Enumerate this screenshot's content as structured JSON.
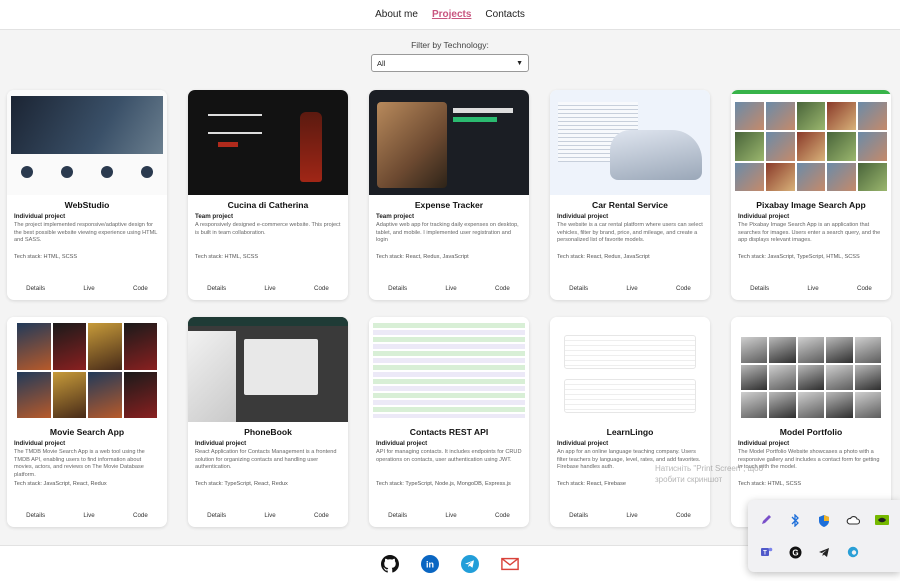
{
  "nav": {
    "items": [
      "About me",
      "Projects",
      "Contacts"
    ],
    "active_index": 1
  },
  "filter": {
    "label": "Filter by Technology:",
    "selected": "All"
  },
  "projects": [
    {
      "title": "WebStudio",
      "type": "Individual project",
      "description": "The project implemented responsive/adaptive design for the best possible website viewing experience using HTML and SASS.",
      "stack": "Tech stack: HTML, SCSS"
    },
    {
      "title": "Cucina di Catherina",
      "type": "Team project",
      "description": "A responsively designed e-commerce website. This project is built in team collaboration.",
      "stack": "Tech stack: HTML, SCSS"
    },
    {
      "title": "Expense Tracker",
      "type": "Team project",
      "description": "Adaptive web app for tracking daily expenses on desktop, tablet, and mobile. I implemented user registration and login",
      "stack": "Tech stack: React, Redux, JavaScript"
    },
    {
      "title": "Car Rental Service",
      "type": "Individual project",
      "description": "The website is a car rental platform where users can select vehicles, filter by brand, price, and mileage, and create a personalized list of favorite models.",
      "stack": "Tech stack: React, Redux, JavaScript"
    },
    {
      "title": "Pixabay Image Search App",
      "type": "Individual project",
      "description": "The Pixabay Image Search App is an application that searches for images. Users enter a search query, and the app displays relevant images.",
      "stack": "Tech stack: JavaScript, TypeScript, HTML, SCSS"
    },
    {
      "title": "Movie Search App",
      "type": "Individual project",
      "description": "The TMDB Movie Search App is a web tool using the TMDB API, enabling users to find information about movies, actors, and reviews on The Movie Database platform.",
      "stack": "Tech stack: JavaScript, React, Redux"
    },
    {
      "title": "PhoneBook",
      "type": "Individual project",
      "description": "React Application for Contacts Management is a frontend solution for organizing contacts and handling user authentication.",
      "stack": "Tech stack: TypeScript, React, Redux"
    },
    {
      "title": "Contacts REST API",
      "type": "Individual project",
      "description": "API for managing contacts. It includes endpoints for CRUD operations on contacts, user authentication using JWT.",
      "stack": "Tech stack: TypeScript, Node.js, MongoDB, Express.js"
    },
    {
      "title": "LearnLingo",
      "type": "Individual project",
      "description": "An app for an online language teaching company. Users filter teachers by language, level, rates, and add favorites. Firebase handles auth.",
      "stack": "Tech stack: React, Firebase"
    },
    {
      "title": "Model Portfolio",
      "type": "Individual project",
      "description": "The Model Portfolio Website showcases a photo with a responsive gallery and includes a contact form for getting in touch with the model.",
      "stack": "Tech stack: HTML, SCSS"
    }
  ],
  "card_links": [
    "Details",
    "Live",
    "Code"
  ],
  "footer_icons": [
    "github-icon",
    "linkedin-icon",
    "telegram-icon",
    "mail-icon"
  ],
  "tray_icons": [
    "pen-icon",
    "bluetooth-icon",
    "shield-icon",
    "cloud-icon",
    "nvidia-icon",
    "teams-icon",
    "grammarly-icon",
    "telegram-icon",
    "edge-icon"
  ],
  "watermark": [
    "Натисніть \"Print Screen\", щоб",
    "зробити скриншот"
  ],
  "colors": {
    "accent": "#c8557f",
    "github": "#111111",
    "linkedin": "#0a66c2",
    "telegram": "#229ed9",
    "mail": "#d9423a"
  }
}
